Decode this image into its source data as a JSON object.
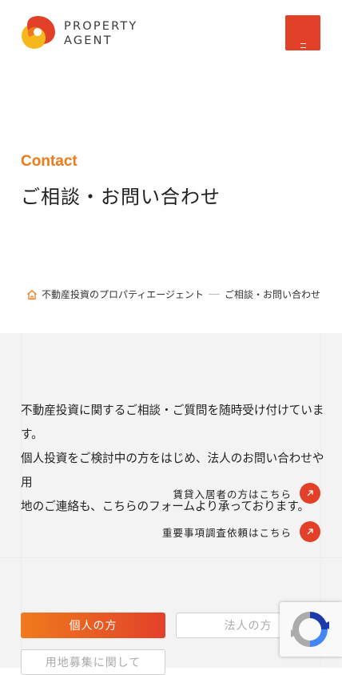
{
  "header": {
    "brand_line1": "PROPERTY",
    "brand_line2": "AGENT",
    "logo_icon": "property-agent-logo",
    "menu_icon": "hamburger-icon",
    "accent_color": "#e3402a"
  },
  "hero": {
    "eyebrow": "Contact",
    "title": "ご相談・お問い合わせ"
  },
  "breadcrumb": {
    "home_icon": "home-icon",
    "items": [
      "不動産投資のプロパティエージェント",
      "ご相談・お問い合わせ"
    ]
  },
  "intro": {
    "line1": "不動産投資に関するご相談・ご質問を随時受け付けています。",
    "line2": "個人投資をご検討中の方をはじめ、法人のお問い合わせや用",
    "line3": "地のご連絡も、こちらのフォームより承っております。"
  },
  "links": [
    {
      "label": "賃貸入居者の方はこちら",
      "icon": "external-arrow-icon"
    },
    {
      "label": "重要事項調査依頼はこちら",
      "icon": "external-arrow-icon"
    }
  ],
  "tabs": {
    "individual": "個人の方",
    "corporate": "法人の方",
    "land": "用地募集に関して"
  },
  "recaptcha_icon": "recaptcha-icon"
}
